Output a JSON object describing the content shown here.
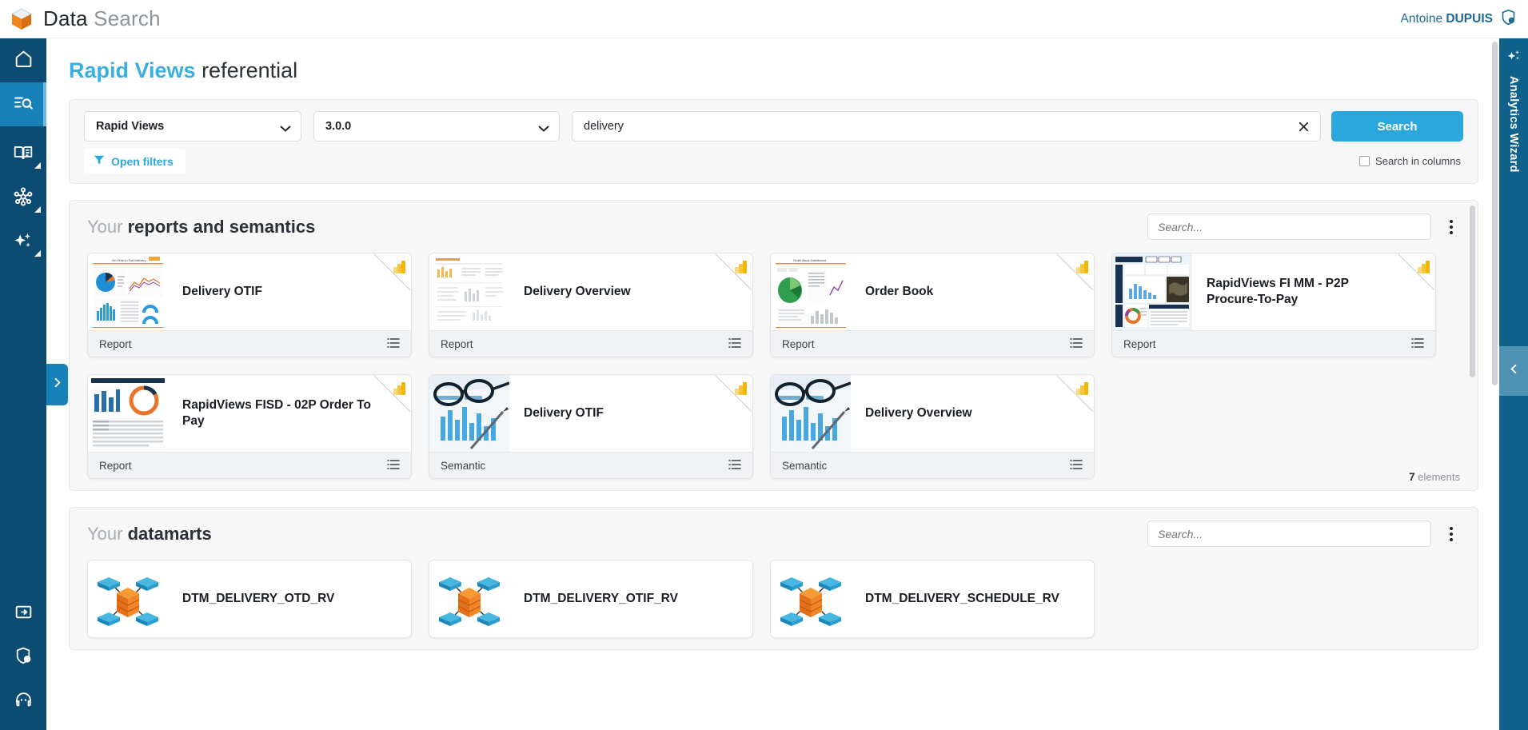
{
  "header": {
    "logo_icon": "cube-logo-icon",
    "title_bold": "Data",
    "title_light": "Search",
    "user_first": "Antoine ",
    "user_last": "DUPUIS",
    "user_icon": "shield-user-icon"
  },
  "left_sidebar": {
    "items": [
      {
        "name": "home",
        "icon": "home-icon",
        "active": false,
        "has_corner": false
      },
      {
        "name": "data-search",
        "icon": "search-list-icon",
        "active": true,
        "has_corner": false
      },
      {
        "name": "glossary",
        "icon": "book-icon",
        "active": false,
        "has_corner": true
      },
      {
        "name": "lineage",
        "icon": "network-nodes-icon",
        "active": false,
        "has_corner": true
      },
      {
        "name": "ai-insights",
        "icon": "sparkles-icon",
        "active": false,
        "has_corner": true
      }
    ],
    "bottom_items": [
      {
        "name": "import",
        "icon": "folder-arrow-icon"
      },
      {
        "name": "security",
        "icon": "shield-user-icon"
      },
      {
        "name": "support",
        "icon": "headset-icon"
      }
    ],
    "expand_icon": "chevron-right-icon"
  },
  "right_sidebar": {
    "wizard_label": "Analytics Wizard",
    "wizard_icon": "sparkles-icon",
    "collapse_icon": "chevron-left-icon"
  },
  "page": {
    "title_accent": "Rapid Views",
    "title_rest": " referential"
  },
  "search": {
    "source_select": "Rapid Views",
    "version_select": "3.0.0",
    "query_value": "delivery",
    "query_placeholder": "",
    "clear_icon": "close-icon",
    "search_button": "Search",
    "open_filters": "Open filters",
    "filter_icon": "funnel-icon",
    "search_in_columns": "Search in columns",
    "search_in_columns_checked": false
  },
  "sections": [
    {
      "title_pre": "Your ",
      "title_strong": "reports and semantics",
      "search_placeholder": "Search...",
      "menu_icon": "kebab-menu-icon",
      "count_value": "7",
      "count_label": "elements",
      "cards": [
        {
          "name": "Delivery OTIF",
          "type": "Report",
          "thumb": "report-dashboard",
          "badge": "powerbi-icon"
        },
        {
          "name": "Delivery Overview",
          "type": "Report",
          "thumb": "report-light",
          "badge": "powerbi-icon"
        },
        {
          "name": "Order Book",
          "type": "Report",
          "thumb": "report-pie",
          "badge": "powerbi-icon"
        },
        {
          "name": "RapidViews FI MM - P2P Procure-To-Pay",
          "type": "Report",
          "thumb": "report-dark",
          "badge": "powerbi-icon"
        },
        {
          "name": "RapidViews FISD - 02P Order To Pay",
          "type": "Report",
          "thumb": "report-table",
          "badge": "powerbi-icon"
        },
        {
          "name": "Delivery OTIF",
          "type": "Semantic",
          "thumb": "photo-glasses",
          "badge": "powerbi-icon"
        },
        {
          "name": "Delivery Overview",
          "type": "Semantic",
          "thumb": "photo-glasses",
          "badge": "powerbi-icon"
        }
      ]
    },
    {
      "title_pre": "Your ",
      "title_strong": "datamarts",
      "search_placeholder": "Search...",
      "menu_icon": "kebab-menu-icon",
      "count_value": "",
      "count_label": "",
      "cards": [
        {
          "name": "DTM_DELIVERY_OTD_RV",
          "type": "",
          "thumb": "datamart-icon",
          "badge": ""
        },
        {
          "name": "DTM_DELIVERY_OTIF_RV",
          "type": "",
          "thumb": "datamart-icon",
          "badge": ""
        },
        {
          "name": "DTM_DELIVERY_SCHEDULE_RV",
          "type": "",
          "thumb": "datamart-icon",
          "badge": ""
        }
      ]
    }
  ],
  "colors": {
    "accent_blue": "#2ba7dd",
    "sidebar_dark": "#0c4b72",
    "sidebar_active": "#1682b8",
    "rightbar": "#0e628c",
    "logo_orange": "#f2841c"
  }
}
